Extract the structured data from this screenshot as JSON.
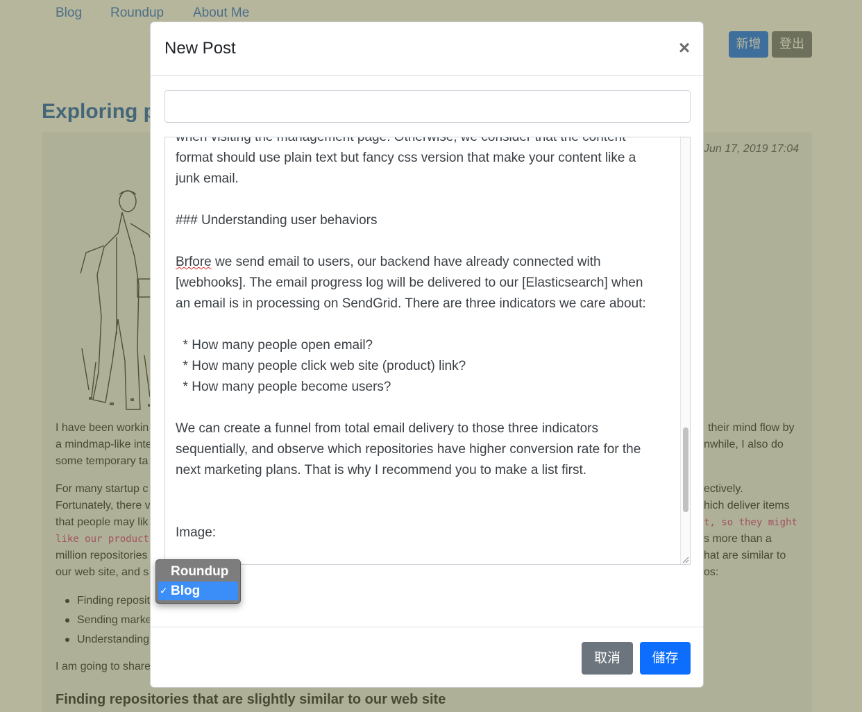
{
  "nav": {
    "links": [
      "Blog",
      "Roundup",
      "About Me"
    ],
    "new_button": "新增",
    "logout_button": "登出"
  },
  "background_post": {
    "title_visible": "Exploring po",
    "date": "Jun 17, 2019 17:04",
    "paragraph1_left": [
      "I have been workin",
      "a mindmap-like inte",
      "some temporary ta"
    ],
    "paragraph1_right": [
      "their mind flow by",
      "nwhile, I also do"
    ],
    "paragraph2_left": [
      "For many startup c",
      "Fortunately, there v",
      "that people may lik",
      "million repositories",
      "our web site, and s"
    ],
    "paragraph2_code_left": "like our product",
    "paragraph2_right": [
      "ectively.",
      "hich deliver items",
      "s more than a",
      "hat are similar to",
      "os:"
    ],
    "paragraph2_code_right": "t, so they might",
    "bullets": [
      "Finding reposit",
      "Sending marke",
      "Understanding"
    ],
    "paragraph3_left": "I am going to share",
    "heading": "Finding repositories that are slightly similar to our web site"
  },
  "modal": {
    "title": "New Post",
    "close_symbol": "×",
    "title_input_value": "",
    "editor": {
      "lines": [
        "",
        "when visiting the management page. Otherwise, we consider that the content",
        "format should use plain text but fancy css version that make your content like a",
        "junk email.",
        "",
        "### Understanding user behaviors",
        "",
        "",
        "[webhooks]. The email progress log will be delivered to our [Elasticsearch] when",
        "an email is in processing on SendGrid. There are three indicators we care about:",
        "",
        "  * How many people open email?",
        "  * How many people click web site (product) link?",
        "  * How many people become users?",
        "",
        "We can create a funnel from total email delivery to those three indicators",
        "sequentially, and observe which repositories have higher conversion rate for the",
        "next marketing plans. That is why I recommend you to make a list first.",
        "",
        "",
        "Image:"
      ],
      "misspelled_word": "Brfore",
      "line8_rest": " we send email to users, our backend have already connected with"
    },
    "category_select": {
      "options": [
        "Roundup",
        "Blog"
      ],
      "selected": "Blog",
      "check_mark": "✓"
    },
    "cancel_button": "取消",
    "save_button": "儲存"
  }
}
